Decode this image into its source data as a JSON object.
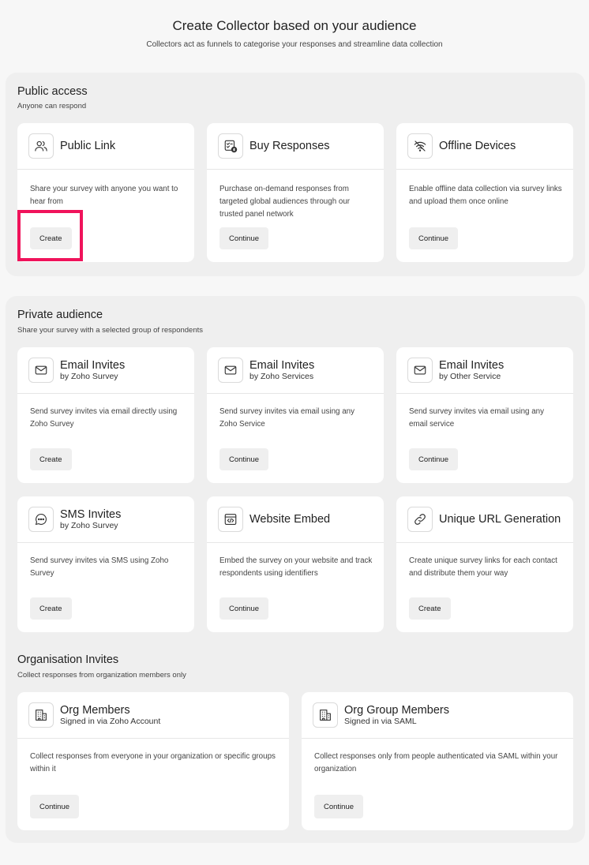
{
  "header": {
    "title": "Create Collector based on your audience",
    "subtitle": "Collectors act as funnels to categorise your responses and streamline data collection"
  },
  "public_access": {
    "title": "Public access",
    "subtitle": "Anyone can respond",
    "cards": [
      {
        "title": "Public Link",
        "desc": "Share your survey with anyone you want to hear from",
        "button": "Create",
        "icon": "users-icon"
      },
      {
        "title": "Buy Responses",
        "desc": "Purchase on-demand responses from targeted global audiences through our trusted panel network",
        "button": "Continue",
        "icon": "checklist-dollar-icon"
      },
      {
        "title": "Offline Devices",
        "desc": "Enable offline data collection via survey links and upload them once online",
        "button": "Continue",
        "icon": "wifi-off-icon"
      }
    ]
  },
  "private_audience": {
    "title": "Private audience",
    "subtitle": "Share your survey with a selected group of respondents",
    "cards": [
      {
        "title": "Email Invites",
        "subtitle": "by Zoho Survey",
        "desc": "Send survey invites via email directly using Zoho Survey",
        "button": "Create",
        "icon": "mail-icon"
      },
      {
        "title": "Email Invites",
        "subtitle": "by Zoho Services",
        "desc": "Send survey invites via email using any Zoho Service",
        "button": "Continue",
        "icon": "mail-icon"
      },
      {
        "title": "Email Invites",
        "subtitle": "by Other Service",
        "desc": "Send survey invites via email using any email service",
        "button": "Continue",
        "icon": "mail-icon"
      },
      {
        "title": "SMS Invites",
        "subtitle": "by Zoho Survey",
        "desc": "Send survey invites via SMS using Zoho Survey",
        "button": "Create",
        "icon": "chat-bubble-icon"
      },
      {
        "title": "Website Embed",
        "desc": "Embed the survey on your website and track respondents using identifiers",
        "button": "Continue",
        "icon": "code-window-icon"
      },
      {
        "title": "Unique URL Generation",
        "desc": "Create unique survey links for each contact and distribute them your way",
        "button": "Create",
        "icon": "link-icon"
      }
    ]
  },
  "organisation_invites": {
    "title": "Organisation Invites",
    "subtitle": "Collect responses from organization members only",
    "cards": [
      {
        "title": "Org Members",
        "subtitle": "Signed in via Zoho Account",
        "desc": "Collect responses from everyone in your organization or specific groups within it",
        "button": "Continue",
        "icon": "building-icon"
      },
      {
        "title": "Org Group Members",
        "subtitle": "Signed in via SAML",
        "desc": "Collect responses only from people authenticated via SAML within your organization",
        "button": "Continue",
        "icon": "building-icon"
      }
    ]
  },
  "colors": {
    "page_bg": "#f7f7f7",
    "section_bg": "#efefef",
    "card_bg": "#ffffff",
    "highlight": "#f0135b"
  }
}
